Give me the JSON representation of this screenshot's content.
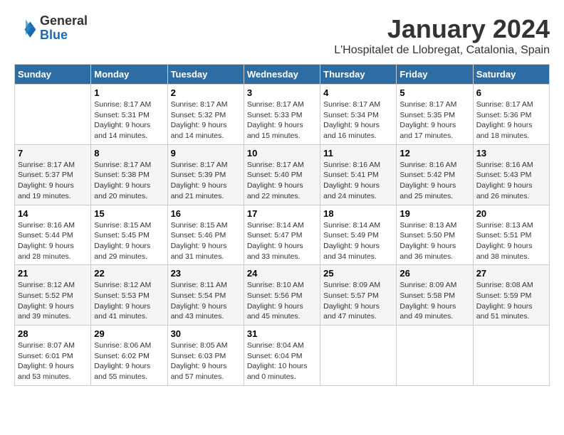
{
  "header": {
    "logo_general": "General",
    "logo_blue": "Blue",
    "month_title": "January 2024",
    "location": "L'Hospitalet de Llobregat, Catalonia, Spain"
  },
  "weekdays": [
    "Sunday",
    "Monday",
    "Tuesday",
    "Wednesday",
    "Thursday",
    "Friday",
    "Saturday"
  ],
  "weeks": [
    [
      {
        "day": "",
        "empty": true
      },
      {
        "day": "1",
        "sunrise": "Sunrise: 8:17 AM",
        "sunset": "Sunset: 5:31 PM",
        "daylight": "Daylight: 9 hours and 14 minutes."
      },
      {
        "day": "2",
        "sunrise": "Sunrise: 8:17 AM",
        "sunset": "Sunset: 5:32 PM",
        "daylight": "Daylight: 9 hours and 14 minutes."
      },
      {
        "day": "3",
        "sunrise": "Sunrise: 8:17 AM",
        "sunset": "Sunset: 5:33 PM",
        "daylight": "Daylight: 9 hours and 15 minutes."
      },
      {
        "day": "4",
        "sunrise": "Sunrise: 8:17 AM",
        "sunset": "Sunset: 5:34 PM",
        "daylight": "Daylight: 9 hours and 16 minutes."
      },
      {
        "day": "5",
        "sunrise": "Sunrise: 8:17 AM",
        "sunset": "Sunset: 5:35 PM",
        "daylight": "Daylight: 9 hours and 17 minutes."
      },
      {
        "day": "6",
        "sunrise": "Sunrise: 8:17 AM",
        "sunset": "Sunset: 5:36 PM",
        "daylight": "Daylight: 9 hours and 18 minutes."
      }
    ],
    [
      {
        "day": "7",
        "sunrise": "Sunrise: 8:17 AM",
        "sunset": "Sunset: 5:37 PM",
        "daylight": "Daylight: 9 hours and 19 minutes."
      },
      {
        "day": "8",
        "sunrise": "Sunrise: 8:17 AM",
        "sunset": "Sunset: 5:38 PM",
        "daylight": "Daylight: 9 hours and 20 minutes."
      },
      {
        "day": "9",
        "sunrise": "Sunrise: 8:17 AM",
        "sunset": "Sunset: 5:39 PM",
        "daylight": "Daylight: 9 hours and 21 minutes."
      },
      {
        "day": "10",
        "sunrise": "Sunrise: 8:17 AM",
        "sunset": "Sunset: 5:40 PM",
        "daylight": "Daylight: 9 hours and 22 minutes."
      },
      {
        "day": "11",
        "sunrise": "Sunrise: 8:16 AM",
        "sunset": "Sunset: 5:41 PM",
        "daylight": "Daylight: 9 hours and 24 minutes."
      },
      {
        "day": "12",
        "sunrise": "Sunrise: 8:16 AM",
        "sunset": "Sunset: 5:42 PM",
        "daylight": "Daylight: 9 hours and 25 minutes."
      },
      {
        "day": "13",
        "sunrise": "Sunrise: 8:16 AM",
        "sunset": "Sunset: 5:43 PM",
        "daylight": "Daylight: 9 hours and 26 minutes."
      }
    ],
    [
      {
        "day": "14",
        "sunrise": "Sunrise: 8:16 AM",
        "sunset": "Sunset: 5:44 PM",
        "daylight": "Daylight: 9 hours and 28 minutes."
      },
      {
        "day": "15",
        "sunrise": "Sunrise: 8:15 AM",
        "sunset": "Sunset: 5:45 PM",
        "daylight": "Daylight: 9 hours and 29 minutes."
      },
      {
        "day": "16",
        "sunrise": "Sunrise: 8:15 AM",
        "sunset": "Sunset: 5:46 PM",
        "daylight": "Daylight: 9 hours and 31 minutes."
      },
      {
        "day": "17",
        "sunrise": "Sunrise: 8:14 AM",
        "sunset": "Sunset: 5:47 PM",
        "daylight": "Daylight: 9 hours and 33 minutes."
      },
      {
        "day": "18",
        "sunrise": "Sunrise: 8:14 AM",
        "sunset": "Sunset: 5:49 PM",
        "daylight": "Daylight: 9 hours and 34 minutes."
      },
      {
        "day": "19",
        "sunrise": "Sunrise: 8:13 AM",
        "sunset": "Sunset: 5:50 PM",
        "daylight": "Daylight: 9 hours and 36 minutes."
      },
      {
        "day": "20",
        "sunrise": "Sunrise: 8:13 AM",
        "sunset": "Sunset: 5:51 PM",
        "daylight": "Daylight: 9 hours and 38 minutes."
      }
    ],
    [
      {
        "day": "21",
        "sunrise": "Sunrise: 8:12 AM",
        "sunset": "Sunset: 5:52 PM",
        "daylight": "Daylight: 9 hours and 39 minutes."
      },
      {
        "day": "22",
        "sunrise": "Sunrise: 8:12 AM",
        "sunset": "Sunset: 5:53 PM",
        "daylight": "Daylight: 9 hours and 41 minutes."
      },
      {
        "day": "23",
        "sunrise": "Sunrise: 8:11 AM",
        "sunset": "Sunset: 5:54 PM",
        "daylight": "Daylight: 9 hours and 43 minutes."
      },
      {
        "day": "24",
        "sunrise": "Sunrise: 8:10 AM",
        "sunset": "Sunset: 5:56 PM",
        "daylight": "Daylight: 9 hours and 45 minutes."
      },
      {
        "day": "25",
        "sunrise": "Sunrise: 8:09 AM",
        "sunset": "Sunset: 5:57 PM",
        "daylight": "Daylight: 9 hours and 47 minutes."
      },
      {
        "day": "26",
        "sunrise": "Sunrise: 8:09 AM",
        "sunset": "Sunset: 5:58 PM",
        "daylight": "Daylight: 9 hours and 49 minutes."
      },
      {
        "day": "27",
        "sunrise": "Sunrise: 8:08 AM",
        "sunset": "Sunset: 5:59 PM",
        "daylight": "Daylight: 9 hours and 51 minutes."
      }
    ],
    [
      {
        "day": "28",
        "sunrise": "Sunrise: 8:07 AM",
        "sunset": "Sunset: 6:01 PM",
        "daylight": "Daylight: 9 hours and 53 minutes."
      },
      {
        "day": "29",
        "sunrise": "Sunrise: 8:06 AM",
        "sunset": "Sunset: 6:02 PM",
        "daylight": "Daylight: 9 hours and 55 minutes."
      },
      {
        "day": "30",
        "sunrise": "Sunrise: 8:05 AM",
        "sunset": "Sunset: 6:03 PM",
        "daylight": "Daylight: 9 hours and 57 minutes."
      },
      {
        "day": "31",
        "sunrise": "Sunrise: 8:04 AM",
        "sunset": "Sunset: 6:04 PM",
        "daylight": "Daylight: 10 hours and 0 minutes."
      },
      {
        "day": "",
        "empty": true
      },
      {
        "day": "",
        "empty": true
      },
      {
        "day": "",
        "empty": true
      }
    ]
  ]
}
